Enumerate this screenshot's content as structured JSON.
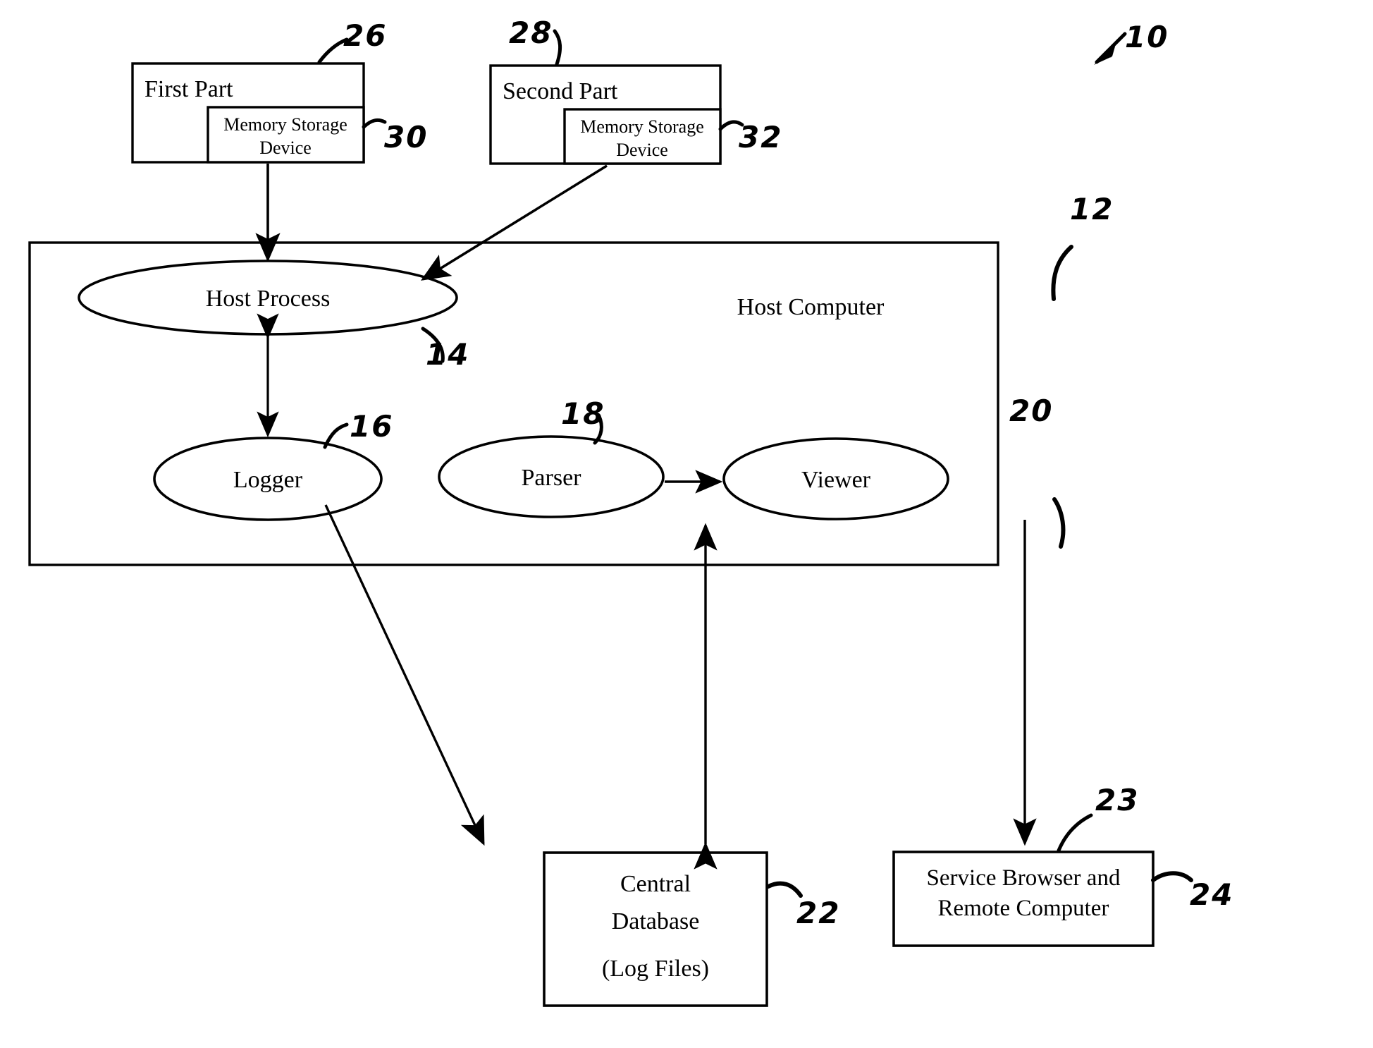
{
  "figure": {
    "kind": "patent-block-diagram",
    "reference_numeral_overall": "10"
  },
  "blocks": {
    "first_part": {
      "title": "First Part",
      "ref": "26",
      "inner": {
        "label": "Memory  Storage\nDevice",
        "ref": "30"
      }
    },
    "second_part": {
      "title": "Second Part",
      "ref": "28",
      "inner": {
        "label": "Memory  Storage\nDevice",
        "ref": "32"
      }
    },
    "host_computer": {
      "title": "Host Computer",
      "ref": "12"
    },
    "central_database": {
      "title": "Central\nDatabase",
      "subtitle": "(Log Files)",
      "ref": "22"
    },
    "service_browser": {
      "title": "Service Browser and\nRemote Computer",
      "ref_top": "23",
      "ref_side": "24"
    }
  },
  "nodes": {
    "host_process": {
      "label": "Host Process",
      "ref": "14"
    },
    "logger": {
      "label": "Logger",
      "ref": "16"
    },
    "parser": {
      "label": "Parser",
      "ref": "18"
    },
    "viewer": {
      "label": "Viewer",
      "ref": "20"
    }
  },
  "connections": [
    {
      "name": "first-part-to-host-process",
      "from": "First Part / Memory Storage Device",
      "to": "Host Process",
      "style": "arrow-down"
    },
    {
      "name": "second-part-to-host-process",
      "from": "Second Part / Memory Storage Device",
      "to": "Host Process",
      "style": "arrow-diagonal"
    },
    {
      "name": "host-process-to-logger",
      "from": "Host Process",
      "to": "Logger",
      "style": "double-arrow-vertical"
    },
    {
      "name": "logger-to-central-database",
      "from": "Logger",
      "to": "Central Database",
      "style": "arrow-diagonal"
    },
    {
      "name": "central-database-to-parser",
      "from": "Central Database",
      "to": "Parser",
      "style": "double-arrow-vertical"
    },
    {
      "name": "parser-to-viewer",
      "from": "Parser",
      "to": "Viewer",
      "style": "arrow-right"
    },
    {
      "name": "viewer-to-service-browser",
      "from": "Viewer",
      "to": "Service Browser and Remote Computer",
      "style": "arrow-down"
    }
  ],
  "colors": {
    "ink": "#000000",
    "paper": "#ffffff"
  }
}
